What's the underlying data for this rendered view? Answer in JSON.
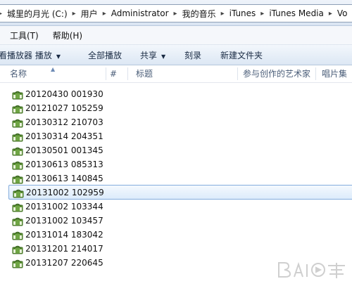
{
  "address": {
    "crumbs": [
      "城里的月光 (C:)",
      "用户",
      "Administrator",
      "我的音乐",
      "iTunes",
      "iTunes Media",
      "Vo"
    ]
  },
  "menu": {
    "items": [
      "工具(T)",
      "帮助(H)"
    ]
  },
  "toolbar": {
    "play_all": "看播放器 播放",
    "play_all_caret": "▼",
    "all_play": "全部播放",
    "share": "共享",
    "share_caret": "▼",
    "burn": "刻录",
    "new_folder": "新建文件夹"
  },
  "columns": {
    "name": "名称",
    "number": "#",
    "title": "标题",
    "artist": "参与创作的艺术家",
    "album": "唱片集"
  },
  "files": [
    {
      "name": "20120430 001930"
    },
    {
      "name": "20121027 105259"
    },
    {
      "name": "20130312 210703"
    },
    {
      "name": "20130314 204351"
    },
    {
      "name": "20130501 001345"
    },
    {
      "name": "20130613 085313"
    },
    {
      "name": "20130613 140845"
    },
    {
      "name": "20131002 102959",
      "selected": true
    },
    {
      "name": "20131002 103344"
    },
    {
      "name": "20131002 103457"
    },
    {
      "name": "20131014 183042"
    },
    {
      "name": "20131201 214017"
    },
    {
      "name": "20131207 220645"
    }
  ],
  "colors": {
    "selection_border": "#84acdd",
    "toolbar_text": "#1a2b44",
    "header_text": "#4a5d78"
  },
  "icons": {
    "file": "audio-file-icon",
    "separator": "chevron-right-icon"
  }
}
